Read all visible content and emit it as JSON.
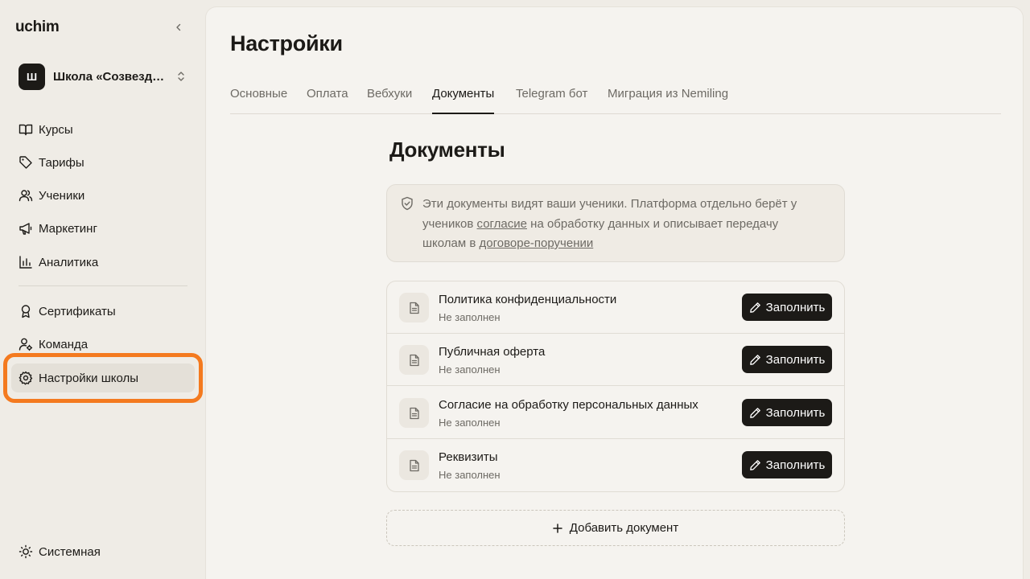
{
  "app": {
    "logo": "uchim"
  },
  "school": {
    "avatar_letter": "Ш",
    "name": "Школа «Созвездие»"
  },
  "sidebar": {
    "items": [
      {
        "label": "Курсы",
        "icon": "book-open-icon"
      },
      {
        "label": "Тарифы",
        "icon": "tag-icon"
      },
      {
        "label": "Ученики",
        "icon": "users-icon"
      },
      {
        "label": "Маркетинг",
        "icon": "megaphone-icon"
      },
      {
        "label": "Аналитика",
        "icon": "bar-chart-icon"
      },
      {
        "label": "Сертификаты",
        "icon": "award-icon"
      },
      {
        "label": "Команда",
        "icon": "user-cog-icon"
      },
      {
        "label": "Настройки школы",
        "icon": "gear-icon",
        "active": true
      }
    ],
    "theme_label": "Системная"
  },
  "header": {
    "title": "Настройки"
  },
  "tabs": [
    {
      "label": "Основные"
    },
    {
      "label": "Оплата"
    },
    {
      "label": "Вебхуки"
    },
    {
      "label": "Документы",
      "active": true
    },
    {
      "label": "Telegram бот"
    },
    {
      "label": "Миграция из Nemiling"
    }
  ],
  "documents": {
    "title": "Документы",
    "info": {
      "text_1": "Эти документы видят ваши ученики. Платформа отдельно берёт у учеников ",
      "link_1": "согласие",
      "text_2": " на обработку данных и описывает передачу школам в ",
      "link_2": "договоре-поручении"
    },
    "items": [
      {
        "title": "Политика конфиденциальности",
        "status": "Не заполнен",
        "action": "Заполнить"
      },
      {
        "title": "Публичная оферта",
        "status": "Не заполнен",
        "action": "Заполнить"
      },
      {
        "title": "Согласие на обработку персональных данных",
        "status": "Не заполнен",
        "action": "Заполнить"
      },
      {
        "title": "Реквизиты",
        "status": "Не заполнен",
        "action": "Заполнить"
      }
    ],
    "add_label": "Добавить документ"
  },
  "colors": {
    "accent_highlight": "#f47a1f",
    "primary_button": "#1c1a17"
  }
}
